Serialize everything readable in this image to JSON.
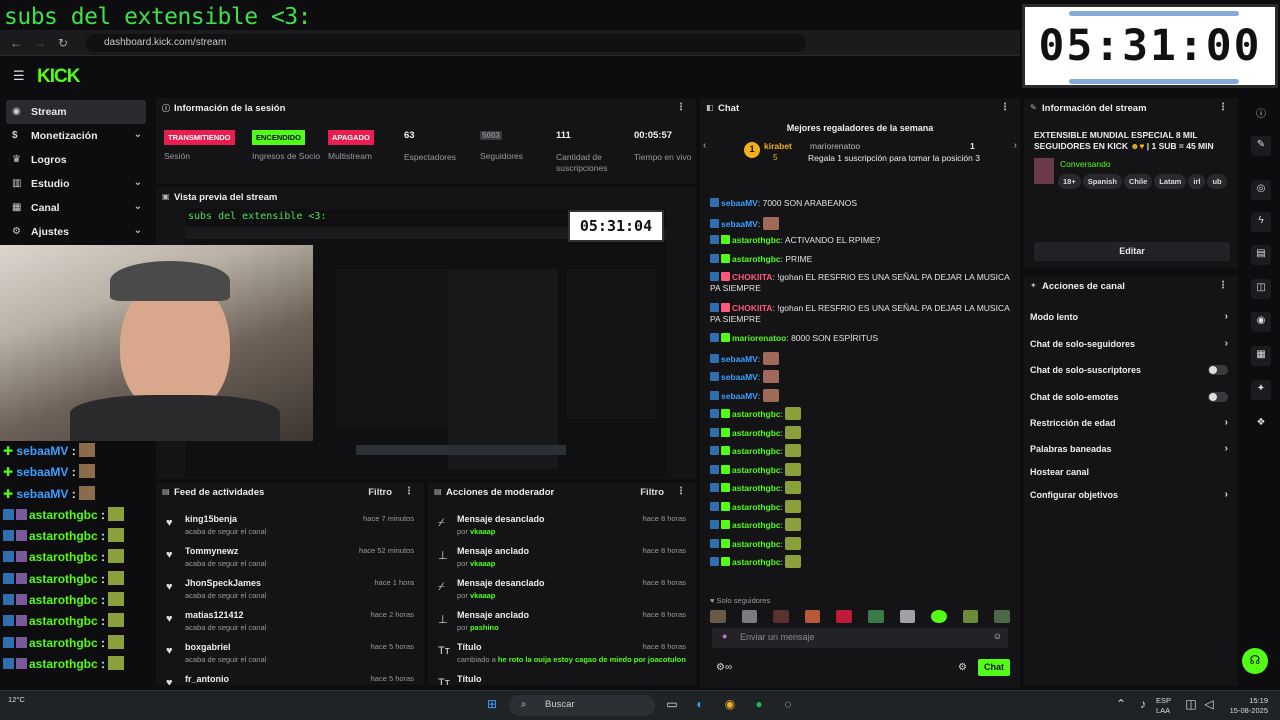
{
  "overlay": {
    "title": "subs del extensible <3:",
    "clock": "05:31:00"
  },
  "browser": {
    "url": "dashboard.kick.com/stream"
  },
  "brand": {
    "logo": "KICK",
    "accent": "#53fc18"
  },
  "nav": {
    "items": [
      {
        "label": "Stream",
        "icon": "stream-icon",
        "chevron": false,
        "active": true
      },
      {
        "label": "Monetización",
        "icon": "money-icon",
        "chevron": true
      },
      {
        "label": "Logros",
        "icon": "trophy-icon",
        "chevron": false
      },
      {
        "label": "Estudio",
        "icon": "studio-icon",
        "chevron": true
      },
      {
        "label": "Canal",
        "icon": "channel-icon",
        "chevron": true
      },
      {
        "label": "Ajustes",
        "icon": "gear-icon",
        "chevron": true
      }
    ]
  },
  "session": {
    "title": "Información de la sesión",
    "stats": [
      {
        "value": "TRANSMITIENDO",
        "label": "Sesión",
        "bg": "#e91e50",
        "fg": "#ffffff"
      },
      {
        "value": "ENCENDIDO",
        "label": "Ingresos de Socio",
        "bg": "#53fc18",
        "fg": "#0d0d0f"
      },
      {
        "value": "APAGADO",
        "label": "Multistream",
        "bg": "#e91e50",
        "fg": "#ffffff"
      },
      {
        "value": "63",
        "label": "Espectadores"
      },
      {
        "value": "5003",
        "label": "Seguidores"
      },
      {
        "value": "111",
        "label": "Cantidad de suscripciones"
      },
      {
        "value": "00:05:57",
        "label": "Tiempo en vivo"
      }
    ]
  },
  "preview": {
    "title": "Vista previa del stream",
    "inner_title": "subs del extensible <3:",
    "inner_clock": "05:31:04"
  },
  "left_chat": [
    {
      "name": "sebaaMV",
      "color": "#3aa0ff"
    },
    {
      "name": "sebaaMV",
      "color": "#3aa0ff"
    },
    {
      "name": "sebaaMV",
      "color": "#3aa0ff"
    },
    {
      "name": "astarothgbc",
      "color": "#53fc18"
    },
    {
      "name": "astarothgbc",
      "color": "#53fc18"
    },
    {
      "name": "astarothgbc",
      "color": "#53fc18"
    },
    {
      "name": "astarothgbc",
      "color": "#53fc18"
    },
    {
      "name": "astarothgbc",
      "color": "#53fc18"
    },
    {
      "name": "astarothgbc",
      "color": "#53fc18"
    },
    {
      "name": "astarothgbc",
      "color": "#53fc18"
    },
    {
      "name": "astarothgbc",
      "color": "#53fc18"
    }
  ],
  "activity": {
    "title": "Feed de actividades",
    "filter": "Filtro",
    "items": [
      {
        "name": "king15benja",
        "sub": "acaba de seguir el canal",
        "time": "hace 7 minutos"
      },
      {
        "name": "Tommynewz",
        "sub": "acaba de seguir el canal",
        "time": "hace 52 minutos"
      },
      {
        "name": "JhonSpeckJames",
        "sub": "acaba de seguir el canal",
        "time": "hace 1 hora"
      },
      {
        "name": "matias121412",
        "sub": "acaba de seguir el canal",
        "time": "hace 2 horas"
      },
      {
        "name": "boxgabriel",
        "sub": "acaba de seguir el canal",
        "time": "hace 5 horas"
      },
      {
        "name": "fr_antonio",
        "sub": "",
        "time": "hace 5 horas"
      }
    ]
  },
  "mod": {
    "title": "Acciones de moderador",
    "filter": "Filtro",
    "items": [
      {
        "name": "Mensaje desanclado",
        "prefix": "por",
        "by": "vkaaap",
        "time": "hace 8 horas",
        "icon": "unpin-icon"
      },
      {
        "name": "Mensaje anclado",
        "prefix": "por",
        "by": "vkaaap",
        "time": "hace 8 horas",
        "icon": "pin-icon"
      },
      {
        "name": "Mensaje desanclado",
        "prefix": "por",
        "by": "vkaaap",
        "time": "hace 8 horas",
        "icon": "unpin-icon"
      },
      {
        "name": "Mensaje anclado",
        "prefix": "por",
        "by": "pashino",
        "time": "hace 8 horas",
        "icon": "pin-icon"
      },
      {
        "name": "Título",
        "prefix": "cambiado a",
        "by": "he roto la ouija estoy cagao de miedo",
        "by2": "por joacotulon",
        "time": "hace 8 horas",
        "icon": "title-icon"
      },
      {
        "name": "Título",
        "prefix": "",
        "by": "",
        "time": "",
        "icon": "title-icon"
      }
    ]
  },
  "chat": {
    "title": "Chat",
    "gifters_title": "Mejores regaladores de la semana",
    "gifter": {
      "rank": "1",
      "name": "kirabet",
      "count": "5",
      "next_user": "mariorenatoo",
      "next_count": "1",
      "cta": "Regala 1 suscripción para tomar la posición 3"
    },
    "messages": [
      {
        "user": "sebaaMV",
        "color": "#3aa0ff",
        "text": "7000 SON ARABEANOS"
      },
      {
        "user": "sebaaMV",
        "color": "#3aa0ff",
        "text": "",
        "emote": true
      },
      {
        "user": "astarothgbc",
        "color": "#53fc18",
        "text": "ACTIVANDO EL RPIME?"
      },
      {
        "user": "astarothgbc",
        "color": "#53fc18",
        "text": "PRIME"
      },
      {
        "user": "CHOKIITA",
        "color": "#ff5a7a",
        "text": "!gohan EL RESFRIO ES UNA SEÑAL PA DEJAR LA MUSICA PA SIEMPRE"
      },
      {
        "user": "CHOKIITA",
        "color": "#ff5a7a",
        "text": "!gohan EL RESFRIO ES UNA SEÑAL PA DEJAR LA MUSICA PA SIEMPRE"
      },
      {
        "user": "mariorenatoo",
        "color": "#53fc18",
        "text": "8000 SON ESPÍRITUS"
      },
      {
        "user": "sebaaMV",
        "color": "#3aa0ff",
        "text": "",
        "emote": true
      },
      {
        "user": "sebaaMV",
        "color": "#3aa0ff",
        "text": "",
        "emote": true
      },
      {
        "user": "sebaaMV",
        "color": "#3aa0ff",
        "text": "",
        "emote": true
      },
      {
        "user": "astarothgbc",
        "color": "#53fc18",
        "text": "",
        "emote": true
      },
      {
        "user": "astarothgbc",
        "color": "#53fc18",
        "text": "",
        "emote": true
      },
      {
        "user": "astarothgbc",
        "color": "#53fc18",
        "text": "",
        "emote": true
      },
      {
        "user": "astarothgbc",
        "color": "#53fc18",
        "text": "",
        "emote": true
      },
      {
        "user": "astarothgbc",
        "color": "#53fc18",
        "text": "",
        "emote": true
      },
      {
        "user": "astarothgbc",
        "color": "#53fc18",
        "text": "",
        "emote": true
      },
      {
        "user": "astarothgbc",
        "color": "#53fc18",
        "text": "",
        "emote": true
      },
      {
        "user": "astarothgbc",
        "color": "#53fc18",
        "text": "",
        "emote": true
      },
      {
        "user": "astarothgbc",
        "color": "#53fc18",
        "text": "",
        "emote": true
      }
    ],
    "mode": "Solo seguidores",
    "input_placeholder": "Enviar un mensaje",
    "send_label": "Chat"
  },
  "stream_info": {
    "title": "Información del stream",
    "stream_title": "EXTENSIBLE MUNDIAL ESPECIAL 8 MIL SEGUIDORES EN KICK",
    "stream_title_tail": "| 1 SUB = 45 MIN",
    "category": "Conversando",
    "tags": [
      "18+",
      "Spanish",
      "Chile",
      "Latam",
      "irl",
      "ub"
    ],
    "edit_label": "Editar"
  },
  "channel_actions": {
    "title": "Acciones de canal",
    "items": [
      {
        "label": "Modo lento",
        "type": "arrow"
      },
      {
        "label": "Chat de solo-seguidores",
        "type": "arrow"
      },
      {
        "label": "Chat de solo-suscriptores",
        "type": "toggle"
      },
      {
        "label": "Chat de solo-emotes",
        "type": "toggle"
      },
      {
        "label": "Restricción de edad",
        "type": "arrow"
      },
      {
        "label": "Palabras baneadas",
        "type": "arrow"
      },
      {
        "label": "Hostear canal",
        "type": "none"
      },
      {
        "label": "Configurar objetivos",
        "type": "arrow"
      }
    ]
  },
  "taskbar": {
    "search": "Buscar",
    "lang": "ESP",
    "lang2": "LAA",
    "time": "15:19",
    "date": "15-08-2025",
    "weather": "12°C"
  }
}
